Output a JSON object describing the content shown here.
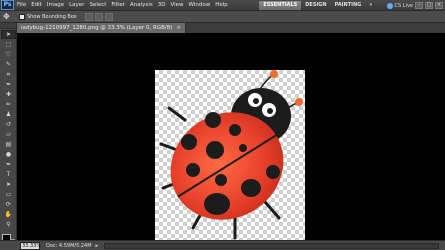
{
  "app": {
    "logo": "Ps"
  },
  "menu": {
    "items": [
      "File",
      "Edit",
      "Image",
      "Layer",
      "Select",
      "Filter",
      "Analysis",
      "3D",
      "View",
      "Window",
      "Help"
    ]
  },
  "workspace": {
    "buttons": [
      "ESSENTIALS",
      "DESIGN",
      "PAINTING"
    ],
    "more": "»",
    "cs_live": "CS Live"
  },
  "window_controls": [
    "–",
    "□",
    "×"
  ],
  "options_bar": {
    "move_tool_icon": "move-tool-icon",
    "show_bounding_box": "Show Bounding Box"
  },
  "document": {
    "tab_label": "ladybug-1210997_1280.png @ 33.3% (Layer 0, RGB/8)",
    "close": "×"
  },
  "status": {
    "zoom": "33.33%",
    "doc_info": "Doc: 4.59M/5.24M",
    "arrow": "▸"
  },
  "colors": {
    "foreground": "#000000",
    "background": "#ffffff",
    "ladybug_red": "#e8412b",
    "ladybug_black": "#1c1c1c",
    "antenna_tip": "#f26b2a"
  }
}
